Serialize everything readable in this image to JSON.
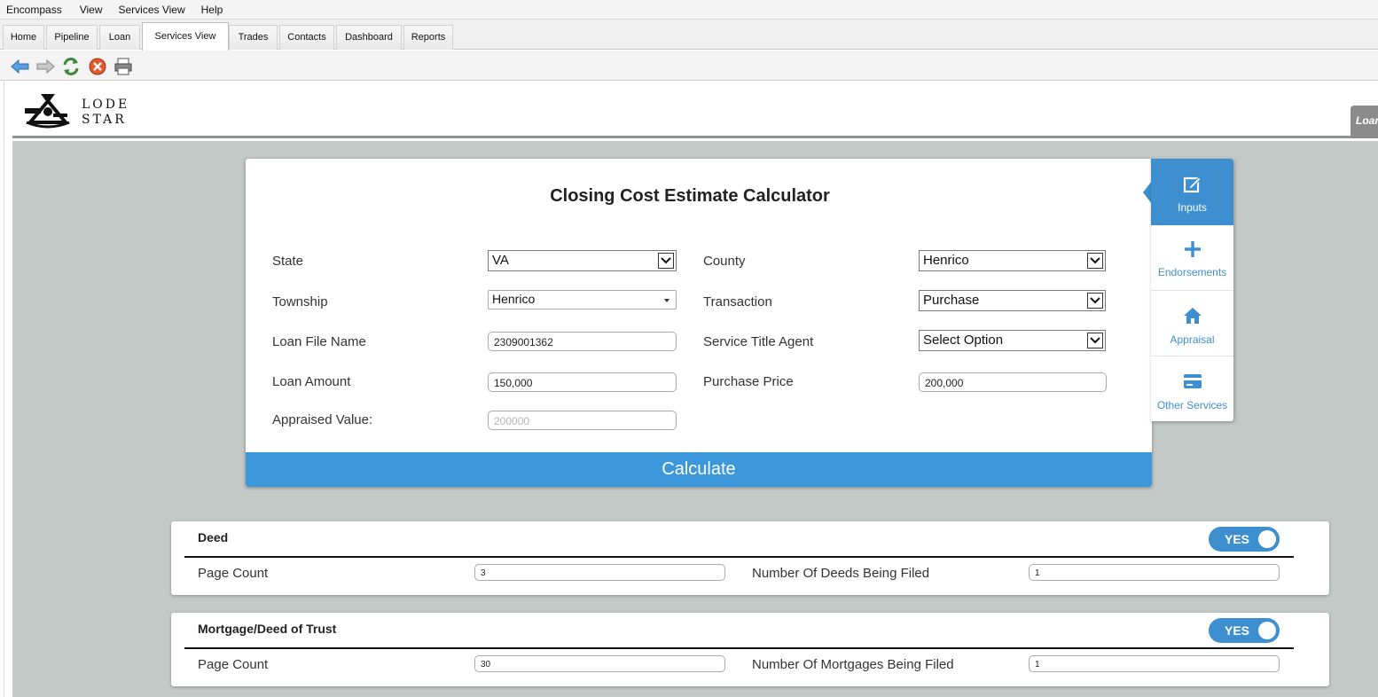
{
  "menu": [
    "Encompass",
    "View",
    "Services View",
    "Help"
  ],
  "tabs": [
    {
      "label": "Home",
      "active": false
    },
    {
      "label": "Pipeline",
      "active": false
    },
    {
      "label": "Loan",
      "active": false
    },
    {
      "label": "Services View",
      "active": true
    },
    {
      "label": "Trades",
      "active": false
    },
    {
      "label": "Contacts",
      "active": false
    },
    {
      "label": "Dashboard",
      "active": false
    },
    {
      "label": "Reports",
      "active": false
    }
  ],
  "toolbar": {
    "buttons": [
      "back-arrow-icon",
      "forward-arrow-icon",
      "refresh-icon",
      "stop-icon",
      "print-icon"
    ]
  },
  "header": {
    "logo_line1": "LODE",
    "logo_line2": "STAR",
    "side_tab": "Loan"
  },
  "calculator": {
    "title": "Closing Cost Estimate Calculator",
    "state_label": "State",
    "state_value": "VA",
    "county_label": "County",
    "county_value": "Henrico",
    "township_label": "Township",
    "township_value": "Henrico",
    "transaction_label": "Transaction",
    "transaction_value": "Purchase",
    "loan_file_label": "Loan File Name",
    "loan_file_value": "2309001362",
    "service_agent_label": "Service Title Agent",
    "service_agent_value": "Select Option",
    "loan_amount_label": "Loan Amount",
    "loan_amount_value": "150,000",
    "purchase_price_label": "Purchase Price",
    "purchase_price_value": "200,000",
    "appraised_label": "Appraised Value:",
    "appraised_placeholder": "200000",
    "calculate_label": "Calculate"
  },
  "sidenav": [
    {
      "label": "Inputs",
      "icon": "edit-icon",
      "active": true
    },
    {
      "label": "Endorsements",
      "icon": "plus-icon",
      "active": false
    },
    {
      "label": "Appraisal",
      "icon": "home-icon",
      "active": false
    },
    {
      "label": "Other Services",
      "icon": "card-icon",
      "active": false
    }
  ],
  "deed": {
    "title": "Deed",
    "toggle": "YES",
    "page_count_label": "Page Count",
    "page_count_value": "3",
    "number_label": "Number Of Deeds Being Filed",
    "number_value": "1"
  },
  "mortgage": {
    "title": "Mortgage/Deed of Trust",
    "toggle": "YES",
    "page_count_label": "Page Count",
    "page_count_value": "30",
    "number_label": "Number Of Mortgages Being Filed",
    "number_value": "1"
  },
  "colors": {
    "accent_blue": "#3d97db",
    "nav_blue": "#3d8fd0",
    "content_gray": "#c3c9c7"
  }
}
